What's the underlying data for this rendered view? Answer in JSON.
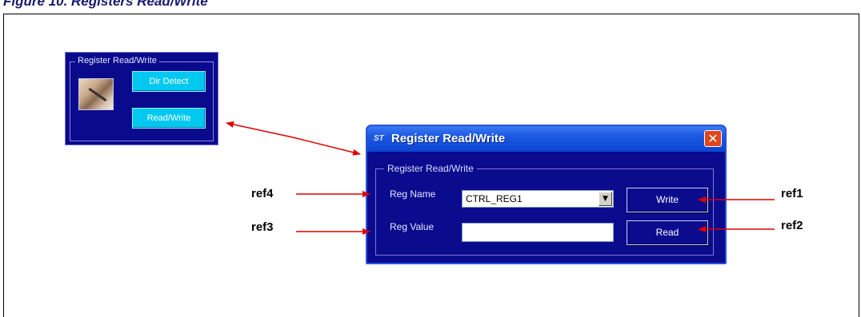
{
  "figure": {
    "title": "Figure 10.   Registers Read/Write"
  },
  "mini_panel": {
    "group_label": "Register Read/Write",
    "dir_detect_label": "Dir Detect",
    "read_write_label": "Read/Write",
    "photo_icon": "hand-writing-photo"
  },
  "dialog": {
    "title": "Register Read/Write",
    "logo_icon": "st-logo",
    "logo_text": "ST",
    "close_icon": "close-icon",
    "close_glyph": "✕",
    "group_label": "Register Read/Write",
    "reg_name_label": "Reg Name",
    "reg_name_value": "CTRL_REG1",
    "dropdown_glyph": "▼",
    "reg_value_label": "Reg Value",
    "reg_value_value": "",
    "write_label": "Write",
    "read_label": "Read"
  },
  "refs": {
    "ref1": "ref1",
    "ref2": "ref2",
    "ref3": "ref3",
    "ref4": "ref4"
  },
  "colors": {
    "panel_bg": "#0a0a8c",
    "titlebar_blue": "#1d58e0",
    "cyan_button": "#00c8f0",
    "arrow_red": "#e00000"
  }
}
